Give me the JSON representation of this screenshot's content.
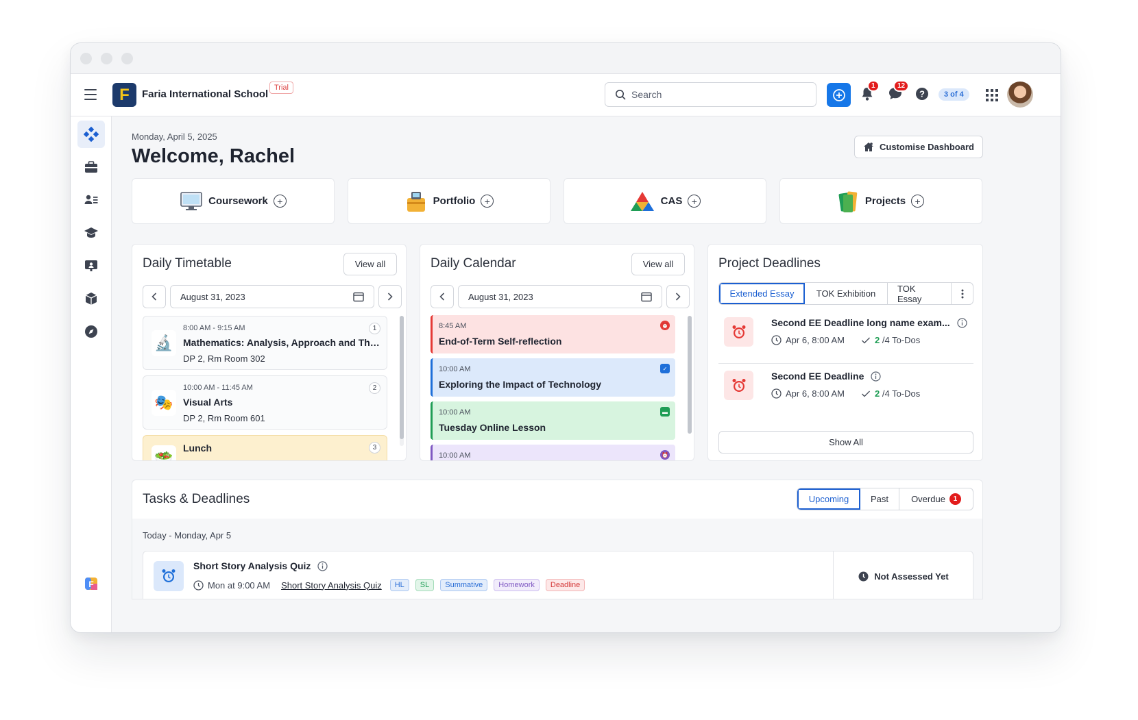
{
  "header": {
    "school_name": "Faria International School",
    "logo_letter": "F",
    "trial_badge": "Trial",
    "search_placeholder": "Search",
    "notifications_count": "1",
    "messages_count": "12",
    "help_progress": "3 of 4"
  },
  "dashboard": {
    "date": "Monday, April 5, 2025",
    "welcome": "Welcome, Rachel",
    "customise_label": "Customise Dashboard"
  },
  "quick_actions": [
    {
      "label": "Coursework",
      "icon": "computer-icon"
    },
    {
      "label": "Portfolio",
      "icon": "portfolio-icon"
    },
    {
      "label": "CAS",
      "icon": "cas-triangle-icon"
    },
    {
      "label": "Projects",
      "icon": "books-icon"
    }
  ],
  "timetable": {
    "title": "Daily Timetable",
    "view_all": "View all",
    "date": "August 31, 2023",
    "items": [
      {
        "time": "8:00 AM - 9:15 AM",
        "subject": "Mathematics: Analysis, Approach and The...",
        "room": "DP 2, Rm Room 302",
        "num": "1",
        "icon": "microscope-icon"
      },
      {
        "time": "10:00 AM - 11:45 AM",
        "subject": "Visual Arts",
        "room": "DP 2, Rm Room 601",
        "num": "2",
        "icon": "theatre-masks-icon"
      },
      {
        "time": "",
        "subject": "Lunch",
        "room": "",
        "num": "3",
        "icon": "lunch-icon"
      }
    ]
  },
  "calendar": {
    "title": "Daily Calendar",
    "view_all": "View all",
    "date": "August 31, 2023",
    "events": [
      {
        "time": "8:45 AM",
        "title": "End-of-Term Self-reflection",
        "bg": "#fde2e2",
        "border": "#e53935",
        "icon_color": "#e53935"
      },
      {
        "time": "10:00 AM",
        "title": "Exploring the Impact of Technology",
        "bg": "#dce9fb",
        "border": "#1e6fd9",
        "icon_color": "#1e6fd9"
      },
      {
        "time": "10:00 AM",
        "title": "Tuesday Online Lesson",
        "bg": "#d7f4df",
        "border": "#1f9d55",
        "icon_color": "#1f9d55"
      },
      {
        "time": "10:00 AM",
        "title": "",
        "bg": "#ece5fb",
        "border": "#7e57c2",
        "icon_color": "#7e57c2"
      }
    ]
  },
  "deadlines": {
    "title": "Project Deadlines",
    "tabs": [
      "Extended Essay",
      "TOK Exhibition",
      "TOK Essay"
    ],
    "items": [
      {
        "title": "Second EE Deadline long name exam...",
        "date": "Apr 6, 8:00 AM",
        "done": "2",
        "total": "/4 To-Dos"
      },
      {
        "title": "Second EE Deadline",
        "date": "Apr 6, 8:00 AM",
        "done": "2",
        "total": "/4 To-Dos"
      }
    ],
    "show_all": "Show All"
  },
  "tasks": {
    "title": "Tasks & Deadlines",
    "tabs": [
      "Upcoming",
      "Past",
      "Overdue"
    ],
    "overdue_count": "1",
    "today_label": "Today - Monday, Apr 5",
    "item": {
      "title": "Short Story Analysis Quiz",
      "time": "Mon at 9:00 AM",
      "link": "Short Story Analysis Quiz",
      "tags": [
        {
          "label": "HL",
          "color": "#2c6fd6",
          "bg": "#e3edfb",
          "border": "#a9c6f1"
        },
        {
          "label": "SL",
          "color": "#1f9d55",
          "bg": "#e2f5e9",
          "border": "#a3dcb9"
        },
        {
          "label": "Summative",
          "color": "#2c6fd6",
          "bg": "#e3edfb",
          "border": "#a9c6f1"
        },
        {
          "label": "Homework",
          "color": "#7e57c2",
          "bg": "#f1ecfb",
          "border": "#cdbdf0"
        },
        {
          "label": "Deadline",
          "color": "#d43a3a",
          "bg": "#fde8e8",
          "border": "#f3b4b4"
        }
      ],
      "status": "Not Assessed Yet"
    }
  },
  "colors": {
    "accent": "#1677e8",
    "alert": "#e21b1b"
  }
}
